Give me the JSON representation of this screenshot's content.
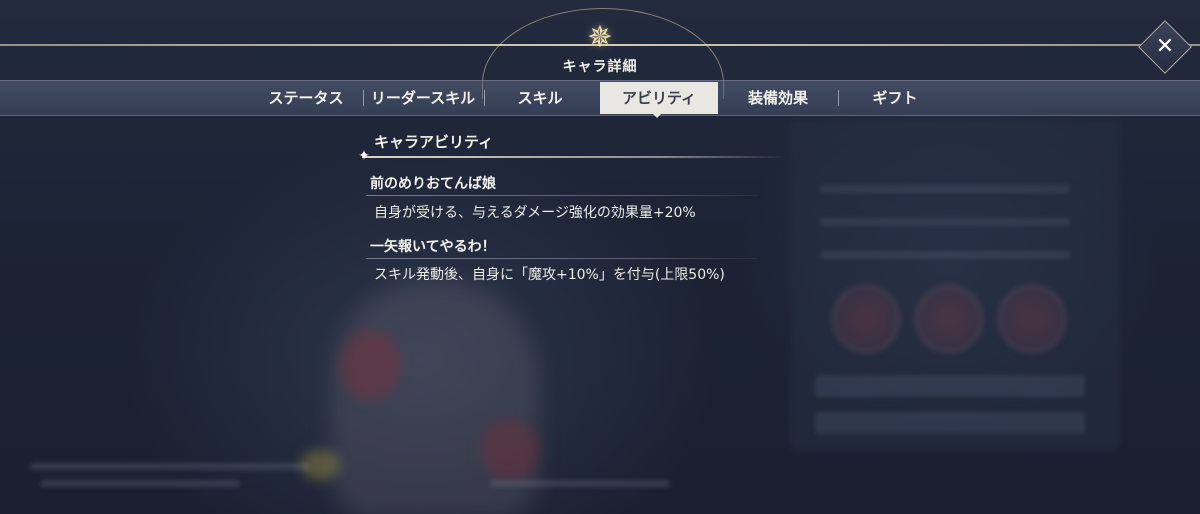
{
  "header": {
    "title": "キャラ詳細",
    "emblem_icon": "compass-star-icon",
    "close_label": "✕"
  },
  "tabs": [
    {
      "label": "ステータス",
      "active": false
    },
    {
      "label": "リーダースキル",
      "active": false
    },
    {
      "label": "スキル",
      "active": false
    },
    {
      "label": "アビリティ",
      "active": true
    },
    {
      "label": "装備効果",
      "active": false
    },
    {
      "label": "ギフト",
      "active": false
    }
  ],
  "ability_panel": {
    "section_title": "キャラアビリティ",
    "abilities": [
      {
        "name": "前のめりおてんば娘",
        "description": "自身が受ける、与えるダメージ強化の効果量+20%"
      },
      {
        "name": "一矢報いてやるわ！",
        "description": "スキル発動後、自身に「魔攻+10%」を付与(上限50%)"
      }
    ]
  },
  "colors": {
    "background": "#1b2234",
    "accent_gold": "#e0d0a0",
    "active_tab_bg": "#e9e7e1",
    "text": "#f4f2ec"
  }
}
